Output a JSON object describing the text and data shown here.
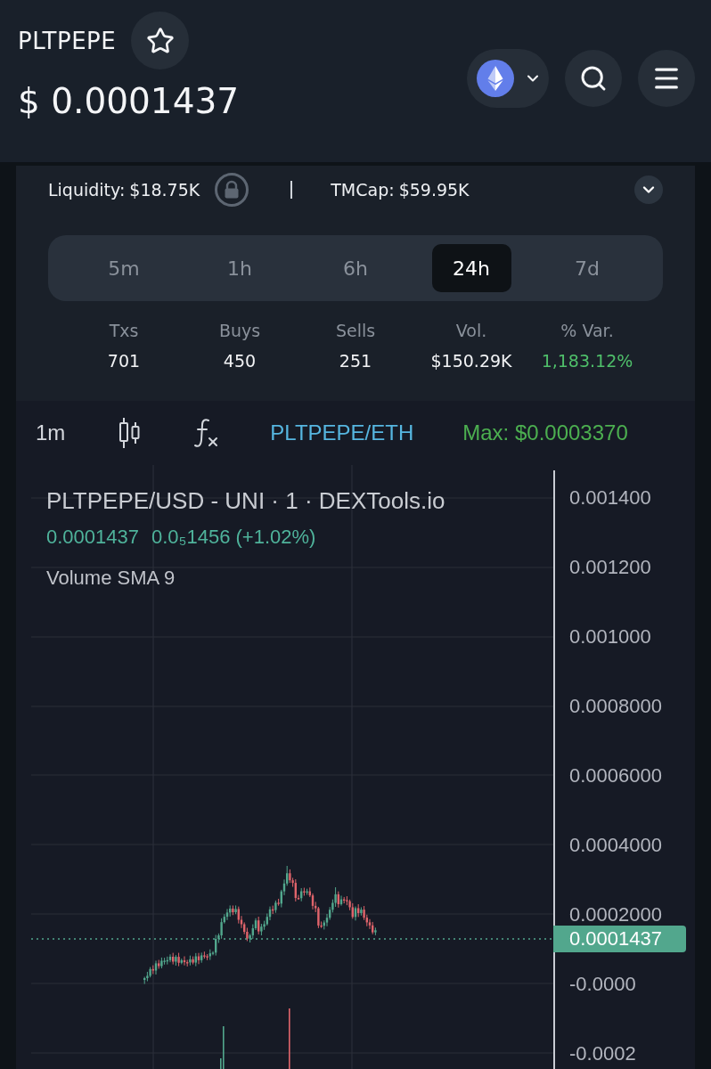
{
  "header": {
    "symbol": "PLTPEPE",
    "favorited": false,
    "price": "$ 0.0001437"
  },
  "pair_info": {
    "liquidity_label": "Liquidity:",
    "liquidity_value": "$18.75K",
    "market_cap_label": "TMCap:",
    "market_cap_value": "$59.95K"
  },
  "periods": [
    {
      "label": "5m",
      "selected": false
    },
    {
      "label": "1h",
      "selected": false
    },
    {
      "label": "6h",
      "selected": false
    },
    {
      "label": "24h",
      "selected": true
    },
    {
      "label": "7d",
      "selected": false
    }
  ],
  "stats": [
    {
      "label": "Txs",
      "value": "701",
      "positive": false
    },
    {
      "label": "Buys",
      "value": "450",
      "positive": false
    },
    {
      "label": "Sells",
      "value": "251",
      "positive": false
    },
    {
      "label": "Vol.",
      "value": "$150.29K",
      "positive": false
    },
    {
      "label": "% Var.",
      "value": "1,183.12%",
      "positive": true
    }
  ],
  "chart_toolbar": {
    "interval": "1m",
    "pair": "PLTPEPE/ETH",
    "max_price": "Max: $0.0003370"
  },
  "chart": {
    "title": "PLTPEPE/USD - UNI · 1 · DEXTools.io",
    "last_price": "0.0001437",
    "change": "0.0₅1456 (+1.02%)",
    "indicator": "Volume SMA 9",
    "price_ticks": [
      "0.001400",
      "0.001200",
      "0.001000",
      "0.0008000",
      "0.0006000",
      "0.0004000",
      "0.0002000",
      "-0.0000",
      "-0.0002"
    ],
    "current_price": "0.0001437"
  }
}
